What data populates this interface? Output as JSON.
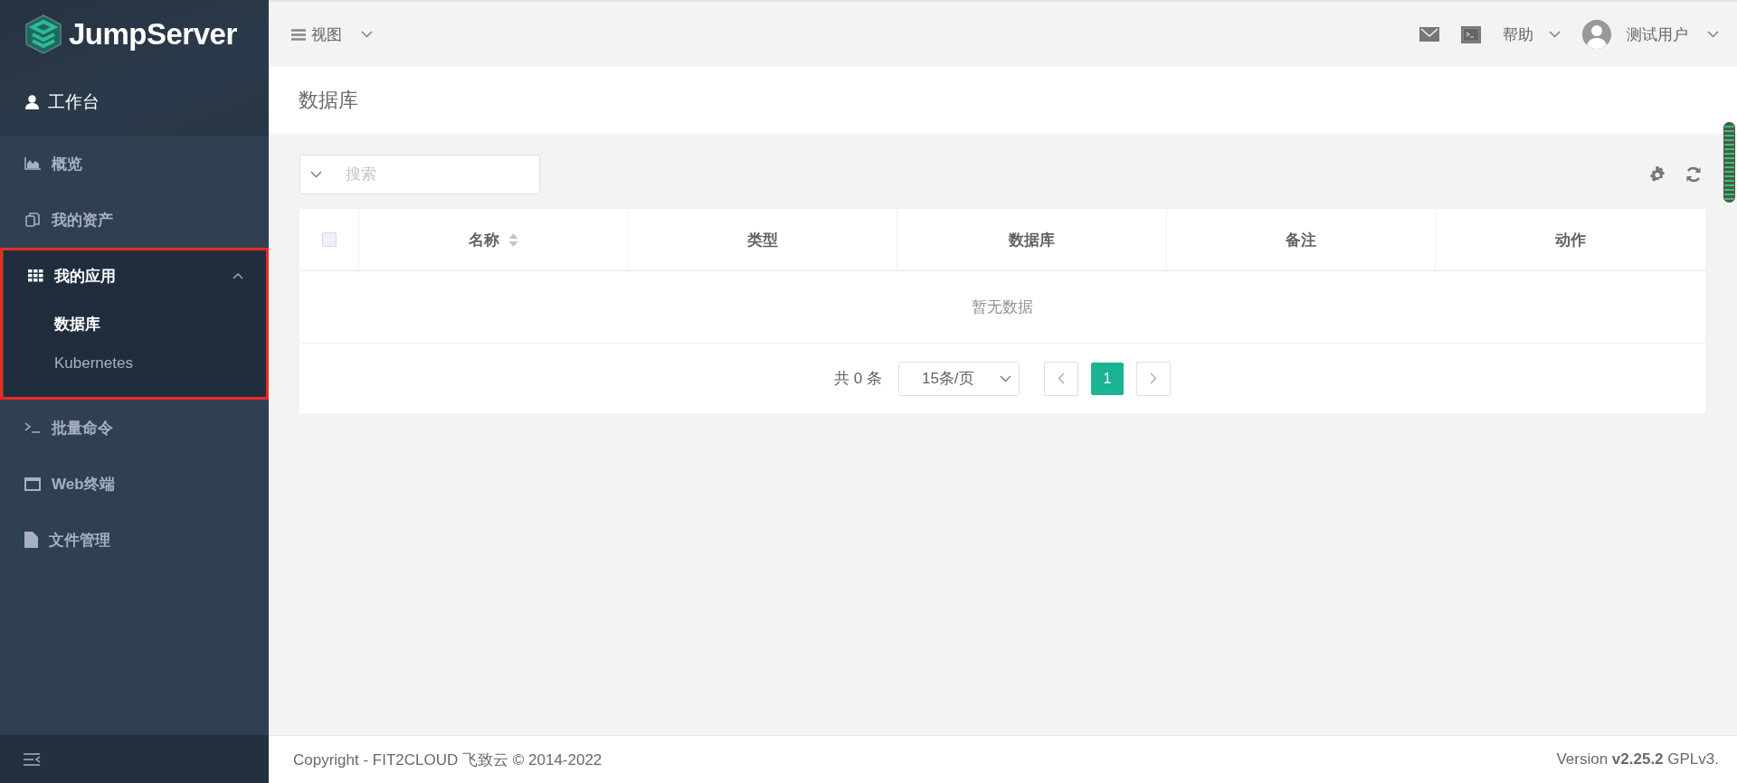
{
  "sidebar": {
    "logo": "JumpServer",
    "workbench": "工作台",
    "items": [
      {
        "label": "概览",
        "kind": "item"
      },
      {
        "label": "我的资产",
        "kind": "item"
      },
      {
        "label": "我的应用",
        "kind": "group",
        "expanded": true,
        "highlighted": true,
        "children": [
          {
            "label": "数据库",
            "selected": true
          },
          {
            "label": "Kubernetes",
            "selected": false
          }
        ]
      },
      {
        "label": "批量命令",
        "kind": "item"
      },
      {
        "label": "Web终端",
        "kind": "item"
      },
      {
        "label": "文件管理",
        "kind": "item"
      }
    ]
  },
  "topbar": {
    "view_menu": "视图",
    "help_menu": "帮助",
    "user_menu": "测试用户"
  },
  "page": {
    "title": "数据库"
  },
  "search": {
    "placeholder": "搜索"
  },
  "table": {
    "header_checkbox": {
      "checked": false
    },
    "columns": [
      {
        "label": "名称",
        "sortable": true
      },
      {
        "label": "类型",
        "sortable": false
      },
      {
        "label": "数据库",
        "sortable": false
      },
      {
        "label": "备注",
        "sortable": false
      },
      {
        "label": "动作",
        "sortable": false
      }
    ],
    "empty_text": "暂无数据"
  },
  "pagination": {
    "total": "共 0 条",
    "page_size": "15条/页",
    "pages": [
      {
        "label": "1",
        "selected": true
      }
    ]
  },
  "footer": {
    "copyright": "Copyright - FIT2CLOUD 飞致云 © 2014-2022",
    "version": "Version **v2.25.2** GPLv3."
  }
}
